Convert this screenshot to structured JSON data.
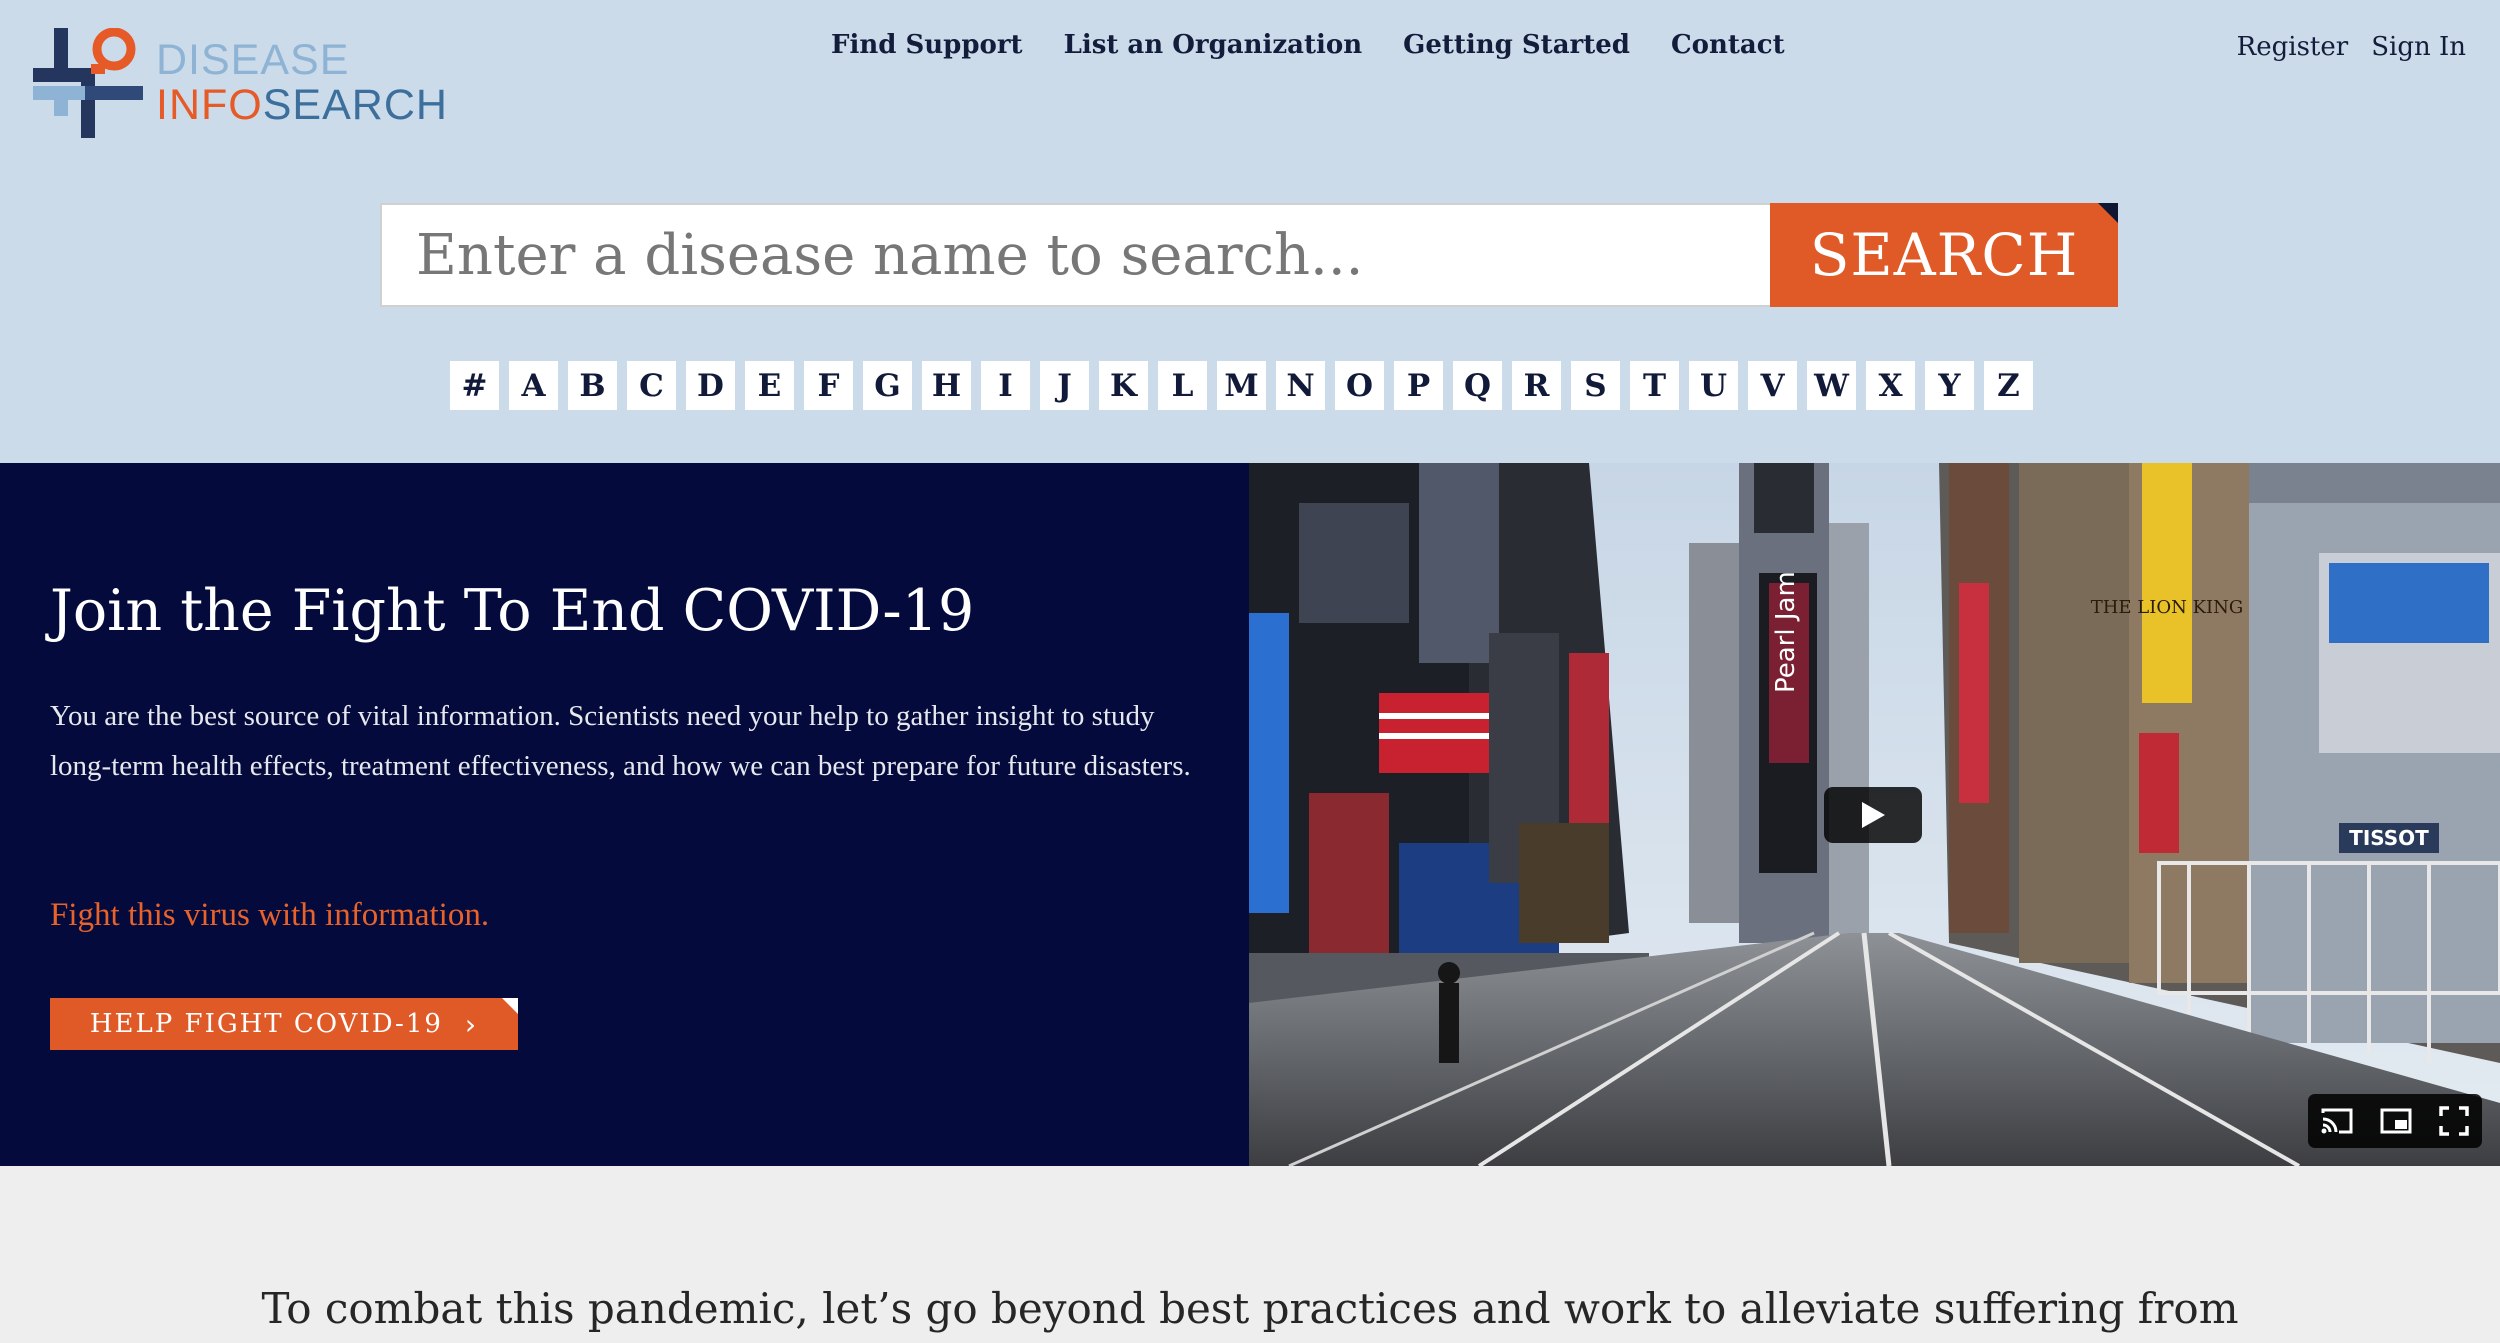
{
  "logo": {
    "line1": "DISEASE",
    "line2_accent": "INFO",
    "line2_rest": "SEARCH"
  },
  "nav": {
    "items": [
      "Find Support",
      "List an Organization",
      "Getting Started",
      "Contact"
    ]
  },
  "auth": {
    "register": "Register",
    "sign_in": "Sign In"
  },
  "search": {
    "placeholder": "Enter a disease name to search...",
    "button_label": "SEARCH"
  },
  "alphabet": [
    "#",
    "A",
    "B",
    "C",
    "D",
    "E",
    "F",
    "G",
    "H",
    "I",
    "J",
    "K",
    "L",
    "M",
    "N",
    "O",
    "P",
    "Q",
    "R",
    "S",
    "T",
    "U",
    "V",
    "W",
    "X",
    "Y",
    "Z"
  ],
  "hero": {
    "title": "Join the Fight To End COVID-19",
    "body": "You are the best source of vital information. Scientists need your help to gather insight to study long-term health effects, treatment effectiveness, and how we can best prepare for future disasters.",
    "tagline": "Fight this virus with information.",
    "cta_label": "HELP FIGHT COVID-19",
    "cta_icon": "chevron-right-icon"
  },
  "video": {
    "signs": {
      "pearl_jam": "Pearl Jam",
      "lion_king": "THE LION KING",
      "tissot": "TISSOT"
    },
    "controls": [
      "cast-icon",
      "picture-in-picture-icon",
      "fullscreen-icon"
    ],
    "play_icon": "play-icon"
  },
  "lower": {
    "text": "To combat this pandemic, let’s go beyond best practices and work to alleviate suffering from"
  },
  "colors": {
    "header_bg": "#cbdbea",
    "accent": "#e05a27",
    "hero_bg": "#040b3c",
    "navy_text": "#141c3c",
    "lower_bg": "#eeeeee"
  }
}
